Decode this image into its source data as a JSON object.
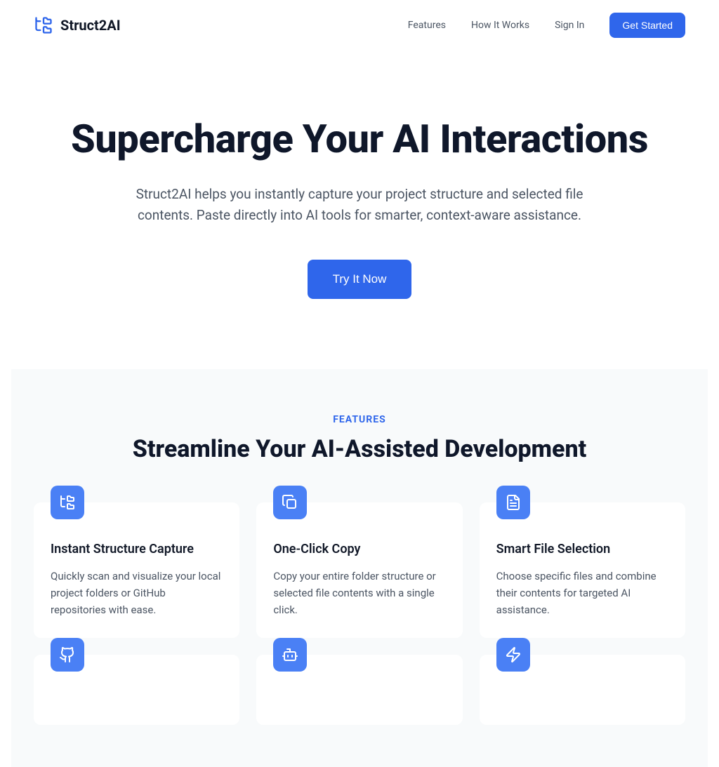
{
  "brand": {
    "name": "Struct2AI"
  },
  "nav": {
    "features": "Features",
    "how": "How It Works",
    "signin": "Sign In",
    "get_started": "Get Started"
  },
  "hero": {
    "title": "Supercharge Your AI Interactions",
    "subtitle": "Struct2AI helps you instantly capture your project structure and selected file contents. Paste directly into AI tools for smarter, context-aware assistance.",
    "cta": "Try It Now"
  },
  "features": {
    "eyebrow": "FEATURES",
    "title": "Streamline Your AI-Assisted Development",
    "cards": [
      {
        "title": "Instant Structure Capture",
        "desc": "Quickly scan and visualize your local project folders or GitHub repositories with ease."
      },
      {
        "title": "One-Click Copy",
        "desc": "Copy your entire folder structure or selected file contents with a single click."
      },
      {
        "title": "Smart File Selection",
        "desc": "Choose specific files and combine their contents for targeted AI assistance."
      },
      {
        "title": "",
        "desc": ""
      },
      {
        "title": "",
        "desc": ""
      },
      {
        "title": "",
        "desc": ""
      }
    ]
  }
}
